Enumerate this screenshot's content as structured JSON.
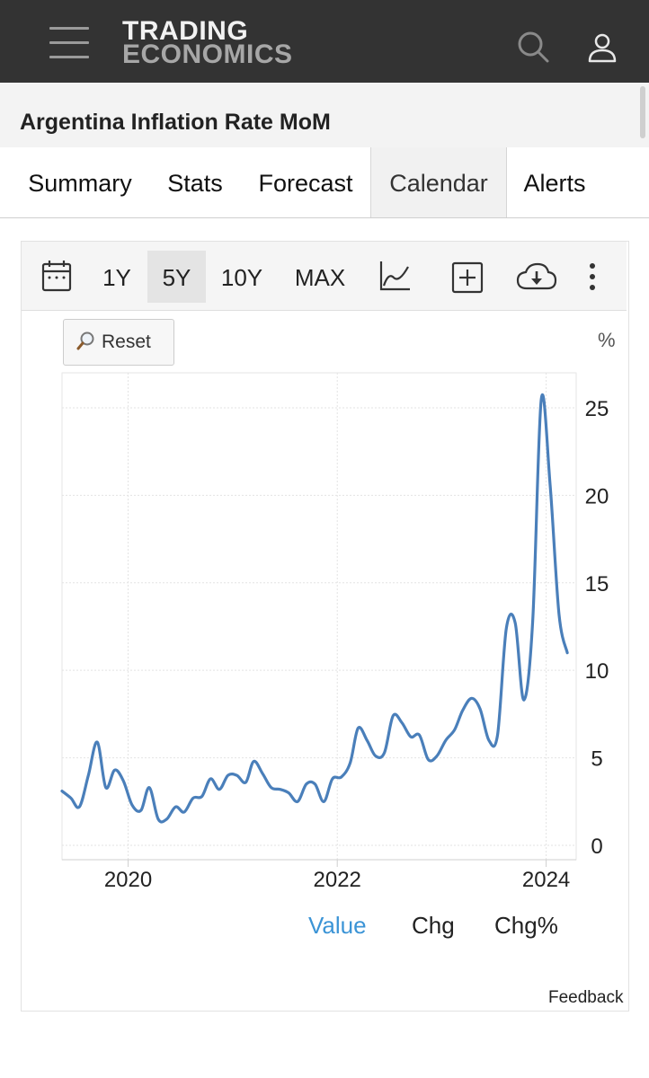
{
  "header": {
    "logo_line1": "TRADING",
    "logo_line2": "ECONOMICS",
    "icons": [
      "menu-icon",
      "search-icon",
      "user-icon"
    ]
  },
  "page": {
    "title": "Argentina Inflation Rate MoM"
  },
  "tabs": [
    {
      "label": "Summary",
      "active": false
    },
    {
      "label": "Stats",
      "active": false
    },
    {
      "label": "Forecast",
      "active": false
    },
    {
      "label": "Calendar",
      "active": true
    },
    {
      "label": "Alerts",
      "active": false
    }
  ],
  "toolbar": {
    "ranges": [
      "1Y",
      "5Y",
      "10Y",
      "MAX"
    ],
    "selected_range": "5Y",
    "icons": [
      "calendar-icon",
      "line-chart-icon",
      "add-series-icon",
      "download-cloud-icon",
      "more-vert-icon"
    ]
  },
  "chart_controls": {
    "reset_label": "Reset",
    "unit": "%"
  },
  "series_toggle": {
    "value": "Value",
    "chg": "Chg",
    "chg_pct": "Chg%",
    "active": "Value"
  },
  "feedback": "Feedback",
  "colors": {
    "line": "#4a7fba",
    "active_toggle": "#3b94d6",
    "header_bg": "#333333"
  },
  "chart_data": {
    "type": "line",
    "title": "",
    "xlabel": "",
    "ylabel": "",
    "ylim": [
      0,
      27
    ],
    "xlim": [
      "2019-05-15",
      "2024-04-15"
    ],
    "yticks": [
      0,
      5,
      10,
      15,
      20,
      25
    ],
    "xticks": [
      "2020",
      "2022",
      "2024"
    ],
    "grid": true,
    "legend": "none",
    "series": [
      {
        "x": [
          "2019-05",
          "2019-06",
          "2019-07",
          "2019-08",
          "2019-09",
          "2019-10",
          "2019-11",
          "2019-12",
          "2020-01",
          "2020-02",
          "2020-03",
          "2020-04",
          "2020-05",
          "2020-06",
          "2020-07",
          "2020-08",
          "2020-09",
          "2020-10",
          "2020-11",
          "2020-12",
          "2021-01",
          "2021-02",
          "2021-03",
          "2021-04",
          "2021-05",
          "2021-06",
          "2021-07",
          "2021-08",
          "2021-09",
          "2021-10",
          "2021-11",
          "2021-12",
          "2022-01",
          "2022-02",
          "2022-03",
          "2022-04",
          "2022-05",
          "2022-06",
          "2022-07",
          "2022-08",
          "2022-09",
          "2022-10",
          "2022-11",
          "2022-12",
          "2023-01",
          "2023-02",
          "2023-03",
          "2023-04",
          "2023-05",
          "2023-06",
          "2023-07",
          "2023-08",
          "2023-09",
          "2023-10",
          "2023-11",
          "2023-12",
          "2024-01",
          "2024-02",
          "2024-03"
        ],
        "values": [
          3.1,
          2.7,
          2.2,
          4.0,
          5.9,
          3.3,
          4.3,
          3.7,
          2.3,
          2.0,
          3.3,
          1.5,
          1.5,
          2.2,
          1.9,
          2.7,
          2.8,
          3.8,
          3.2,
          4.0,
          4.0,
          3.6,
          4.8,
          4.1,
          3.3,
          3.2,
          3.0,
          2.5,
          3.5,
          3.5,
          2.5,
          3.8,
          3.9,
          4.7,
          6.7,
          6.0,
          5.1,
          5.3,
          7.4,
          7.0,
          6.2,
          6.3,
          4.9,
          5.1,
          6.0,
          6.6,
          7.7,
          8.4,
          7.8,
          6.0,
          6.3,
          12.4,
          12.7,
          8.3,
          12.8,
          25.5,
          20.6,
          13.2,
          11.0
        ]
      }
    ]
  }
}
